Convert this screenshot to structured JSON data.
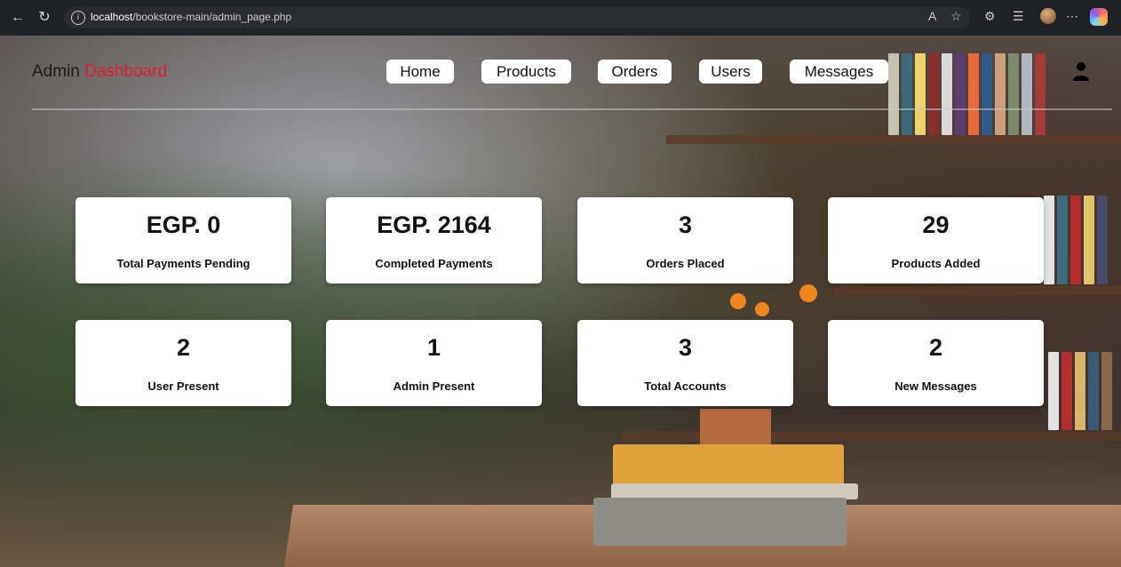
{
  "browser": {
    "url_host": "localhost",
    "url_path": "/bookstore-main/admin_page.php"
  },
  "header": {
    "brand_main": "Admin",
    "brand_accent": "Dashboard",
    "nav": [
      "Home",
      "Products",
      "Orders",
      "Users",
      "Messages"
    ]
  },
  "stats": [
    {
      "value": "EGP. 0",
      "label": "Total Payments Pending"
    },
    {
      "value": "EGP. 2164",
      "label": "Completed Payments"
    },
    {
      "value": "3",
      "label": "Orders Placed"
    },
    {
      "value": "29",
      "label": "Products Added"
    },
    {
      "value": "2",
      "label": "User Present"
    },
    {
      "value": "1",
      "label": "Admin Present"
    },
    {
      "value": "3",
      "label": "Total Accounts"
    },
    {
      "value": "2",
      "label": "New Messages"
    }
  ],
  "colors": {
    "accent": "#e21b2b"
  },
  "icons": {
    "user": "user-icon"
  }
}
